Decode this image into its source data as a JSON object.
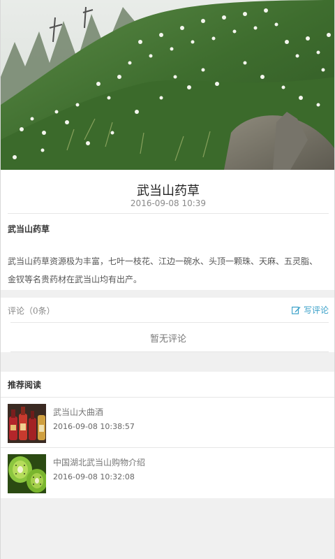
{
  "article": {
    "title": "武当山药草",
    "date": "2016-09-08 10:39",
    "subheading": "武当山药草",
    "body": "武当山药草资源极为丰富，七叶一枝花、江边一碗水、头顶一颗珠、天麻、五灵脂、金钗等名贵药材在武当山均有出产。"
  },
  "comments": {
    "count_label": "评论（0条）",
    "write_label": "写评论",
    "empty_label": "暂无评论"
  },
  "recommend": {
    "heading": "推荐阅读",
    "items": [
      {
        "name": "武当山大曲酒",
        "time": "2016-09-08 10:38:57"
      },
      {
        "name": "中国湖北武当山购物介绍",
        "time": "2016-09-08 10:32:08"
      }
    ]
  },
  "icons": {
    "write": "edit-icon"
  },
  "colors": {
    "accent": "#3aa0c8",
    "background": "#f0f0f0"
  }
}
